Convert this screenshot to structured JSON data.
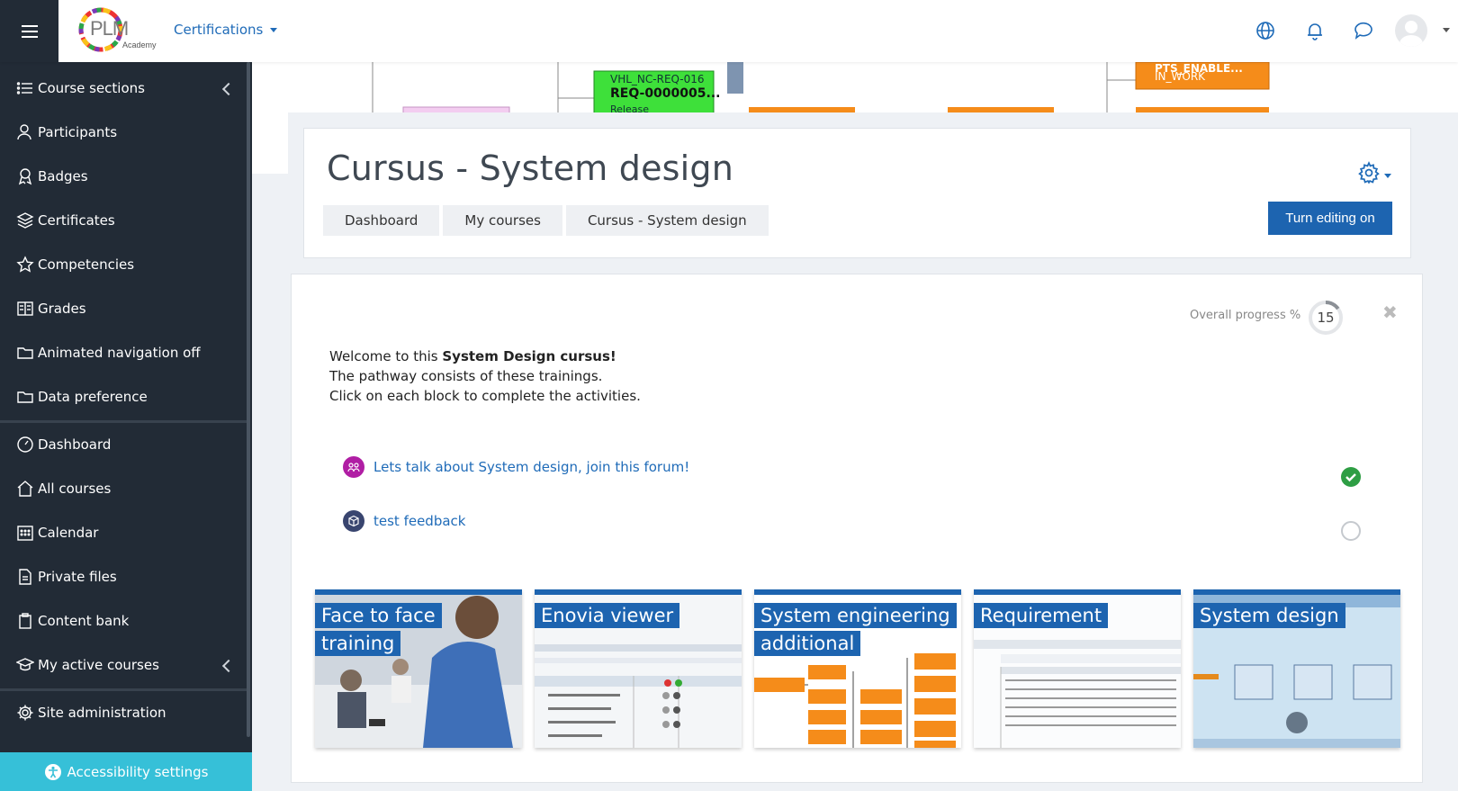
{
  "topbar": {
    "nav_label": "Certifications",
    "logo_text": "PLM",
    "logo_sub": "Academy",
    "icons": [
      "globe-icon",
      "bell-icon",
      "chat-icon",
      "avatar"
    ]
  },
  "sidebar": {
    "items": [
      {
        "label": "Course sections",
        "icon": "list-icon"
      },
      {
        "label": "Participants",
        "icon": "user-icon"
      },
      {
        "label": "Badges",
        "icon": "badge-icon"
      },
      {
        "label": "Certificates",
        "icon": "layers-icon"
      },
      {
        "label": "Competencies",
        "icon": "star-icon"
      },
      {
        "label": "Grades",
        "icon": "book-icon"
      },
      {
        "label": "Animated navigation off",
        "icon": "folder-icon"
      },
      {
        "label": "Data preference",
        "icon": "folder-icon"
      },
      {
        "label": "Dashboard",
        "icon": "gauge-icon"
      },
      {
        "label": "All courses",
        "icon": "home-icon"
      },
      {
        "label": "Calendar",
        "icon": "calendar-icon"
      },
      {
        "label": "Private files",
        "icon": "file-icon"
      },
      {
        "label": "Content bank",
        "icon": "clipboard-icon"
      },
      {
        "label": "My active courses",
        "icon": "graduation-icon"
      },
      {
        "label": "Site administration",
        "icon": "gear-icon"
      }
    ],
    "accessibility_label": "Accessibility settings"
  },
  "banner": {
    "node1_line1": "VHL_NC-REQ-016",
    "node1_line2": "REQ-0000005...",
    "node1_line3": "Release",
    "node2_line1": "PTS_ENABLE...",
    "node2_line2": "IN_WORK"
  },
  "header": {
    "title": "Cursus - System design",
    "breadcrumb": [
      "Dashboard",
      "My courses",
      "Cursus - System design"
    ],
    "edit_button": "Turn editing on"
  },
  "content": {
    "progress_label": "Overall progress %",
    "progress_value": "15",
    "progress_fraction": 0.15,
    "welcome_line1_prefix": "Welcome to this ",
    "welcome_line1_bold": "System Design cursus!",
    "welcome_line2": "The pathway consists of these trainings.",
    "welcome_line3": "Click on each block to complete the activities.",
    "activities": [
      {
        "label": "Lets talk about System design, join this forum!",
        "icon": "forum-icon",
        "status": "complete"
      },
      {
        "label": "test feedback",
        "icon": "feedback-icon",
        "status": "incomplete"
      }
    ],
    "tiles": [
      {
        "line1": "Face to face",
        "line2": "training"
      },
      {
        "line1": "Enovia viewer",
        "line2": ""
      },
      {
        "line1": "System engineering",
        "line2": "additional"
      },
      {
        "line1": "Requirement",
        "line2": ""
      },
      {
        "line1": "System design",
        "line2": ""
      }
    ]
  },
  "colors": {
    "sidebar_bg": "#222b36",
    "accent": "#1d64b0",
    "accessibility": "#36c0d8",
    "success": "#2e9e44"
  }
}
